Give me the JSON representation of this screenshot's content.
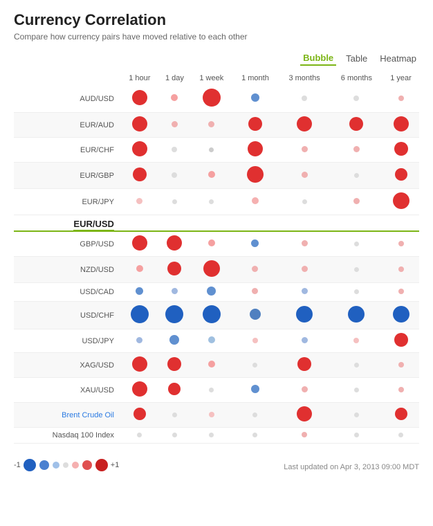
{
  "title": "Currency Correlation",
  "subtitle": "Compare how currency pairs have moved relative to each other",
  "viewToggle": {
    "options": [
      "Bubble",
      "Table",
      "Heatmap"
    ],
    "active": "Bubble"
  },
  "columns": [
    "1 hour",
    "1 day",
    "1 week",
    "1 month",
    "3 months",
    "6 months",
    "1 year"
  ],
  "rows": [
    {
      "pair": "AUD/USD",
      "highlight": false,
      "values": [
        {
          "color": "#e03030",
          "size": 22
        },
        {
          "color": "#f5a0a0",
          "size": 10
        },
        {
          "color": "#e03030",
          "size": 26
        },
        {
          "color": "#6090d0",
          "size": 12
        },
        {
          "color": "#ddd",
          "size": 8
        },
        {
          "color": "#ddd",
          "size": 8
        },
        {
          "color": "#f0b0b0",
          "size": 8
        }
      ]
    },
    {
      "pair": "EUR/AUD",
      "highlight": false,
      "values": [
        {
          "color": "#e03030",
          "size": 22
        },
        {
          "color": "#f0b0b0",
          "size": 9
        },
        {
          "color": "#f0b0b0",
          "size": 9
        },
        {
          "color": "#e03030",
          "size": 20
        },
        {
          "color": "#e03030",
          "size": 22
        },
        {
          "color": "#e03030",
          "size": 20
        },
        {
          "color": "#e03030",
          "size": 22
        }
      ]
    },
    {
      "pair": "EUR/CHF",
      "highlight": false,
      "values": [
        {
          "color": "#e03030",
          "size": 22
        },
        {
          "color": "#ddd",
          "size": 8
        },
        {
          "color": "#ccc",
          "size": 7
        },
        {
          "color": "#e03030",
          "size": 22
        },
        {
          "color": "#f0b0b0",
          "size": 9
        },
        {
          "color": "#f0b0b0",
          "size": 9
        },
        {
          "color": "#e03030",
          "size": 20
        }
      ]
    },
    {
      "pair": "EUR/GBP",
      "highlight": false,
      "values": [
        {
          "color": "#e03030",
          "size": 20
        },
        {
          "color": "#ddd",
          "size": 8
        },
        {
          "color": "#f5a0a0",
          "size": 10
        },
        {
          "color": "#e03030",
          "size": 24
        },
        {
          "color": "#f0b0b0",
          "size": 9
        },
        {
          "color": "#ddd",
          "size": 7
        },
        {
          "color": "#e03030",
          "size": 18
        }
      ]
    },
    {
      "pair": "EUR/JPY",
      "highlight": false,
      "values": [
        {
          "color": "#f5c0c0",
          "size": 9
        },
        {
          "color": "#ddd",
          "size": 7
        },
        {
          "color": "#ddd",
          "size": 7
        },
        {
          "color": "#f5b0b0",
          "size": 10
        },
        {
          "color": "#ddd",
          "size": 7
        },
        {
          "color": "#f0b0b0",
          "size": 9
        },
        {
          "color": "#e03030",
          "size": 24
        }
      ]
    },
    {
      "pair": "EUR/USD",
      "highlight": true,
      "values": [
        {
          "color": "transparent",
          "size": 0
        },
        {
          "color": "transparent",
          "size": 0
        },
        {
          "color": "transparent",
          "size": 0
        },
        {
          "color": "transparent",
          "size": 0
        },
        {
          "color": "transparent",
          "size": 0
        },
        {
          "color": "transparent",
          "size": 0
        },
        {
          "color": "transparent",
          "size": 0
        }
      ]
    },
    {
      "pair": "GBP/USD",
      "highlight": false,
      "values": [
        {
          "color": "#e03030",
          "size": 22
        },
        {
          "color": "#e03030",
          "size": 22
        },
        {
          "color": "#f5a0a0",
          "size": 10
        },
        {
          "color": "#6090d0",
          "size": 11
        },
        {
          "color": "#f0b0b0",
          "size": 9
        },
        {
          "color": "#ddd",
          "size": 7
        },
        {
          "color": "#f0b0b0",
          "size": 8
        }
      ]
    },
    {
      "pair": "NZD/USD",
      "highlight": false,
      "values": [
        {
          "color": "#f5a0a0",
          "size": 10
        },
        {
          "color": "#e03030",
          "size": 20
        },
        {
          "color": "#e03030",
          "size": 24
        },
        {
          "color": "#f0b0b0",
          "size": 9
        },
        {
          "color": "#f0b0b0",
          "size": 9
        },
        {
          "color": "#ddd",
          "size": 7
        },
        {
          "color": "#f0b0b0",
          "size": 8
        }
      ]
    },
    {
      "pair": "USD/CAD",
      "highlight": false,
      "values": [
        {
          "color": "#6090d0",
          "size": 11
        },
        {
          "color": "#a0b8e0",
          "size": 9
        },
        {
          "color": "#6090d0",
          "size": 13
        },
        {
          "color": "#f0b0b0",
          "size": 9
        },
        {
          "color": "#a0b8e0",
          "size": 9
        },
        {
          "color": "#ddd",
          "size": 7
        },
        {
          "color": "#f0b0b0",
          "size": 8
        }
      ]
    },
    {
      "pair": "USD/CHF",
      "highlight": false,
      "values": [
        {
          "color": "#2060c0",
          "size": 26
        },
        {
          "color": "#2060c0",
          "size": 26
        },
        {
          "color": "#2060c0",
          "size": 26
        },
        {
          "color": "#5080c0",
          "size": 16
        },
        {
          "color": "#2060c0",
          "size": 24
        },
        {
          "color": "#2060c0",
          "size": 24
        },
        {
          "color": "#2060c0",
          "size": 24
        }
      ]
    },
    {
      "pair": "USD/JPY",
      "highlight": false,
      "values": [
        {
          "color": "#a0b8e0",
          "size": 9
        },
        {
          "color": "#6090d0",
          "size": 14
        },
        {
          "color": "#a0c0e0",
          "size": 10
        },
        {
          "color": "#f5c0c0",
          "size": 8
        },
        {
          "color": "#a0b8e0",
          "size": 9
        },
        {
          "color": "#f5c0c0",
          "size": 8
        },
        {
          "color": "#e03030",
          "size": 20
        }
      ]
    },
    {
      "pair": "XAG/USD",
      "highlight": false,
      "values": [
        {
          "color": "#e03030",
          "size": 22
        },
        {
          "color": "#e03030",
          "size": 20
        },
        {
          "color": "#f5a0a0",
          "size": 10
        },
        {
          "color": "#ddd",
          "size": 7
        },
        {
          "color": "#e03030",
          "size": 20
        },
        {
          "color": "#ddd",
          "size": 7
        },
        {
          "color": "#f0b0b0",
          "size": 8
        }
      ]
    },
    {
      "pair": "XAU/USD",
      "highlight": false,
      "values": [
        {
          "color": "#e03030",
          "size": 22
        },
        {
          "color": "#e03030",
          "size": 18
        },
        {
          "color": "#ddd",
          "size": 7
        },
        {
          "color": "#6090d0",
          "size": 12
        },
        {
          "color": "#f0b0b0",
          "size": 9
        },
        {
          "color": "#ddd",
          "size": 7
        },
        {
          "color": "#f0b0b0",
          "size": 8
        }
      ]
    },
    {
      "pair": "Brent Crude Oil",
      "highlight": false,
      "pairColor": "#2a7ae2",
      "values": [
        {
          "color": "#e03030",
          "size": 18
        },
        {
          "color": "#ddd",
          "size": 7
        },
        {
          "color": "#f5c0c0",
          "size": 8
        },
        {
          "color": "#ddd",
          "size": 7
        },
        {
          "color": "#e03030",
          "size": 22
        },
        {
          "color": "#ddd",
          "size": 7
        },
        {
          "color": "#e03030",
          "size": 18
        }
      ]
    },
    {
      "pair": "Nasdaq 100\nIndex",
      "highlight": false,
      "values": [
        {
          "color": "#ddd",
          "size": 7
        },
        {
          "color": "#ddd",
          "size": 7
        },
        {
          "color": "#ddd",
          "size": 7
        },
        {
          "color": "#ddd",
          "size": 7
        },
        {
          "color": "#f0b0b0",
          "size": 8
        },
        {
          "color": "#ddd",
          "size": 7
        },
        {
          "color": "#ddd",
          "size": 7
        }
      ]
    }
  ],
  "legend": {
    "label_neg": "-1",
    "label_pos": "+1",
    "bubbles": [
      {
        "color": "#2060c0",
        "size": 18
      },
      {
        "color": "#4a80d0",
        "size": 14
      },
      {
        "color": "#a0c0e8",
        "size": 10
      },
      {
        "color": "#ddd",
        "size": 8
      },
      {
        "color": "#f5b0b0",
        "size": 10
      },
      {
        "color": "#e05050",
        "size": 14
      },
      {
        "color": "#c82020",
        "size": 18
      }
    ]
  },
  "footer": "Last updated on Apr 3, 2013 09:00 MDT"
}
